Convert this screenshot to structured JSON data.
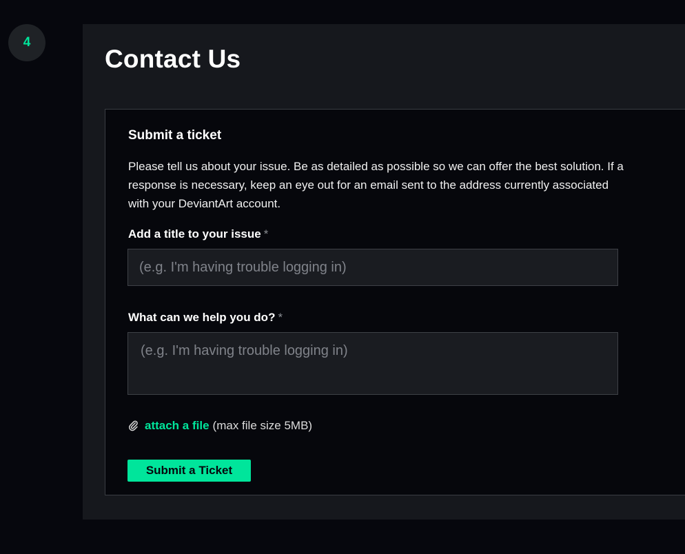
{
  "step": {
    "number": "4"
  },
  "page": {
    "title": "Contact Us"
  },
  "form": {
    "heading": "Submit a ticket",
    "description": "Please tell us about your issue. Be as detailed as possible so we can offer the best solution. If a response is necessary, keep an eye out for an email sent to the address currently associated with your DeviantArt account.",
    "title_field": {
      "label": "Add a title to your issue",
      "required_mark": "*",
      "placeholder": "(e.g. I'm having trouble logging in)",
      "value": ""
    },
    "help_field": {
      "label": "What can we help you do?",
      "required_mark": "*",
      "placeholder": "(e.g. I'm having trouble logging in)",
      "value": ""
    },
    "attachment": {
      "icon": "paperclip-icon",
      "link_label": "attach a file",
      "note": "(max file size 5MB)"
    },
    "submit_label": "Submit a Ticket"
  },
  "colors": {
    "accent": "#00e59b",
    "page_background": "#06070d",
    "panel_background": "#16181d",
    "card_background": "#06070c"
  }
}
